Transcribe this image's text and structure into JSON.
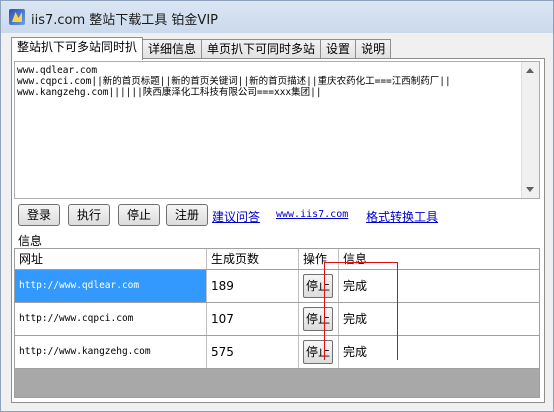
{
  "window": {
    "title": "iis7.com 整站下载工具 铂金VIP"
  },
  "tabs": [
    {
      "label": "整站扒下可多站同时扒",
      "active": true
    },
    {
      "label": "详细信息",
      "active": false
    },
    {
      "label": "单页扒下可同时多站",
      "active": false
    },
    {
      "label": "设置",
      "active": false
    },
    {
      "label": "说明",
      "active": false
    }
  ],
  "textarea": {
    "lines": [
      "www.qdlear.com",
      "www.cqpci.com||新的首页标题||新的首页关键词||新的首页描述||重庆农药化工===江西制药厂||",
      "www.kangzehg.com||||||陕西康泽化工科技有限公司===xxx集团||"
    ]
  },
  "buttons": {
    "login": "登录",
    "execute": "执行",
    "stop": "停止",
    "register": "注册"
  },
  "links": {
    "feedback": "建议问答",
    "site": "www.iis7.com",
    "format_tool": "格式转换工具"
  },
  "info_label": "信息",
  "grid": {
    "columns": [
      "网址",
      "生成页数",
      "操作",
      "信息"
    ],
    "rows": [
      {
        "url": "http://www.qdlear.com",
        "pages": "189",
        "action": "停止",
        "info": "完成",
        "selected": true
      },
      {
        "url": "http://www.cqpci.com",
        "pages": "107",
        "action": "停止",
        "info": "完成",
        "selected": false
      },
      {
        "url": "http://www.kangzehg.com",
        "pages": "575",
        "action": "停止",
        "info": "完成",
        "selected": false
      }
    ]
  },
  "colors": {
    "selection": "#3399ff",
    "link": "#0000cc",
    "annotation": "#e01010"
  }
}
